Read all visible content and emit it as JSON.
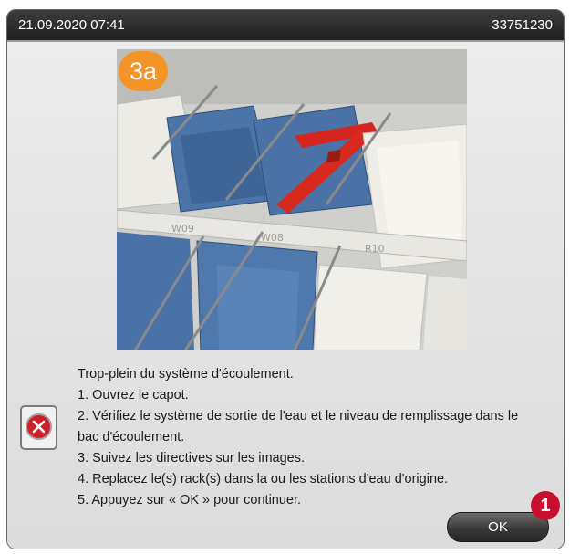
{
  "titlebar": {
    "datetime": "21.09.2020 07:41",
    "device_id": "33751230"
  },
  "image": {
    "step_badge": "3a",
    "rack_labels": [
      "W09",
      "W08",
      "R10"
    ],
    "colors": {
      "badge": "#f29427",
      "bath_blue": "#4a73a8",
      "rack_red": "#d4261f",
      "bath_white": "#eeece6"
    }
  },
  "dialog": {
    "icon": "error-x-icon",
    "lines": [
      "Trop-plein du système d'écoulement.",
      "1. Ouvrez le capot.",
      "2. Vérifiez le système de sortie de l'eau et le niveau de remplissage dans le",
      "bac d'écoulement.",
      "3. Suivez les directives sur les images.",
      "4. Replacez le(s) rack(s) dans la ou les stations d'eau d'origine.",
      "5. Appuyez sur « OK » pour continuer."
    ],
    "ok_label": "OK"
  },
  "annotation": {
    "callout_number": "1",
    "color": "#c8102e"
  }
}
